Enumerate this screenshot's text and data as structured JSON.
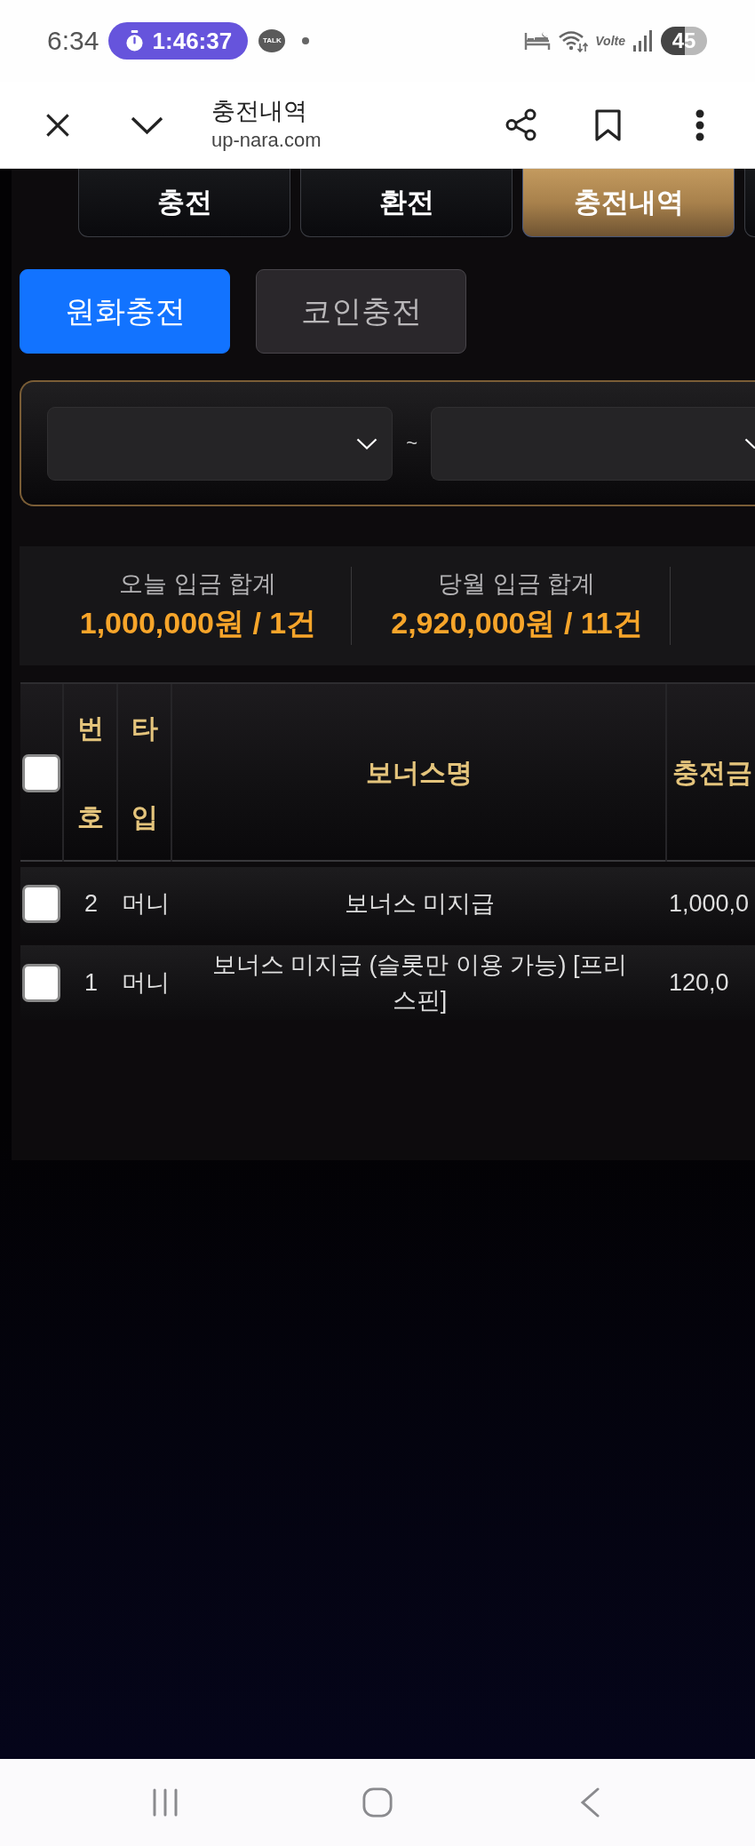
{
  "status_bar": {
    "time": "6:34",
    "timer": "1:46:37",
    "talk_badge": "TALK",
    "network": "Volte",
    "battery": "45"
  },
  "browser_bar": {
    "title": "충전내역",
    "url": "up-nara.com"
  },
  "tabs": [
    {
      "label": "충전",
      "selected": false
    },
    {
      "label": "환전",
      "selected": false
    },
    {
      "label": "충전내역",
      "selected": true
    },
    {
      "selected": false
    }
  ],
  "currency_tabs": [
    {
      "label": "원화충전",
      "selected": true
    },
    {
      "label": "코인충전",
      "selected": false
    }
  ],
  "date_filter": {
    "separator": "~"
  },
  "summary": [
    {
      "label": "오늘 입금 합계",
      "value": "1,000,000원 / 1건"
    },
    {
      "label": "당월 입금 합계",
      "value": "2,920,000원 / 11건"
    }
  ],
  "table": {
    "select_all_checked": false,
    "columns": [
      "번호",
      "타입",
      "보너스명",
      "충전금"
    ],
    "rows": [
      {
        "checked": false,
        "number": "2",
        "type": "머니",
        "bonus_name": "보너스 미지급",
        "amount": "1,000,0"
      },
      {
        "checked": false,
        "number": "1",
        "type": "머니",
        "bonus_name": "보너스 미지급 (슬롯만 이용 가능) [프리스핀]",
        "amount": "120,0"
      }
    ]
  }
}
